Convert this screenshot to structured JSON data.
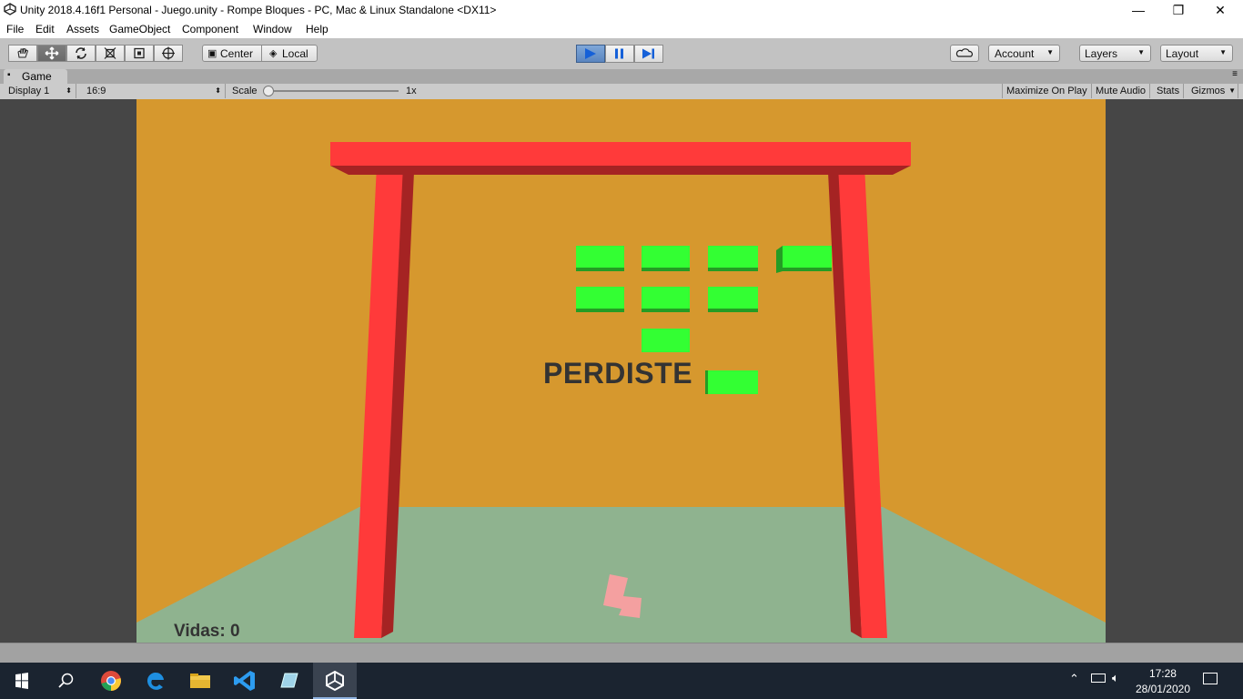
{
  "window": {
    "title": "Unity 2018.4.16f1 Personal - Juego.unity - Rompe Bloques - PC, Mac & Linux Standalone <DX11>",
    "minimize": "—",
    "maximize": "❐",
    "close": "✕"
  },
  "menu": [
    "File",
    "Edit",
    "Assets",
    "GameObject",
    "Component",
    "Window",
    "Help"
  ],
  "toolbar": {
    "tools": [
      "hand-icon",
      "move-icon",
      "rotate-icon",
      "scale-icon",
      "rect-icon",
      "transform-icon"
    ],
    "pivot_label": "Center",
    "space_label": "Local",
    "account_label": "Account",
    "layers_label": "Layers",
    "layout_label": "Layout"
  },
  "game_tab": {
    "tab_label": "Game",
    "display": "Display 1",
    "aspect": "16:9",
    "scale_label": "Scale",
    "scale_value": "1x",
    "maximize_on_play": "Maximize On Play",
    "mute_audio": "Mute Audio",
    "stats": "Stats",
    "gizmos": "Gizmos"
  },
  "game": {
    "message": "PERDISTE",
    "lives_label": "Vidas: 0",
    "colors": {
      "background": "#d6982e",
      "floor": "#8fb38f",
      "frame": "#ff3a3a",
      "frame_shadow": "#a52323",
      "brick": "#33ff33",
      "brick_shadow": "#249c24",
      "paddle": "#f4a0a0"
    }
  },
  "taskbar": {
    "apps": [
      "windows-start-icon",
      "search-icon",
      "chrome-icon",
      "edge-icon",
      "file-explorer-icon",
      "vscode-icon",
      "notes-icon",
      "unity-icon"
    ],
    "time": "17:28",
    "date": "28/01/2020"
  }
}
